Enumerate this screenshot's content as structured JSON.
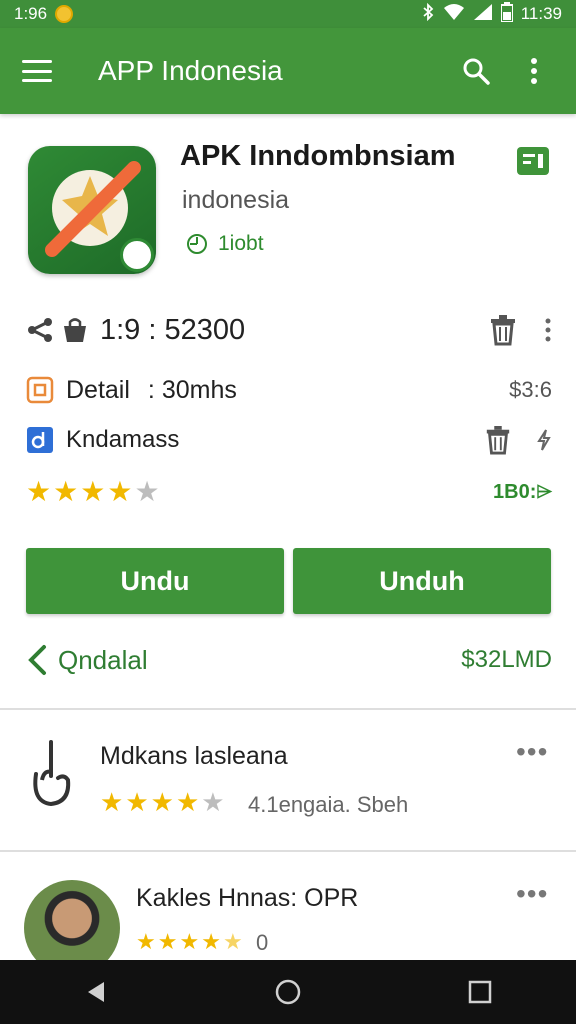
{
  "status_bar": {
    "time_left": "1:96",
    "time_right": "11:39"
  },
  "appbar": {
    "title": "APP Indonesia",
    "icons": [
      "menu-icon",
      "search-icon",
      "overflow-menu-icon"
    ]
  },
  "app": {
    "name": "APK Inndombnsiam",
    "developer": "indonesia",
    "meta": "1iobt"
  },
  "info": {
    "code": "1:9 : 52300",
    "detail_label": "Detail",
    "detail_value": ": 30mhs",
    "detail_price": "$3:6",
    "category": "Kndamass",
    "rating_stars": 4,
    "rating_count": "1B0:⌲"
  },
  "buttons": {
    "left": "Undu",
    "right": "Unduh"
  },
  "link_row": {
    "back_label": "Qndalal",
    "price": "$32LMD"
  },
  "reviews": [
    {
      "name": "Mdkans lasleana",
      "stars": 4,
      "meta": "4.1engaia. Sbeh"
    },
    {
      "name": "Kakles Hnnas: OPR",
      "stars": 4.5,
      "meta": "0"
    }
  ],
  "colors": {
    "primary": "#43963b",
    "accent_green": "#2e8b2e",
    "star": "#f1b800"
  }
}
